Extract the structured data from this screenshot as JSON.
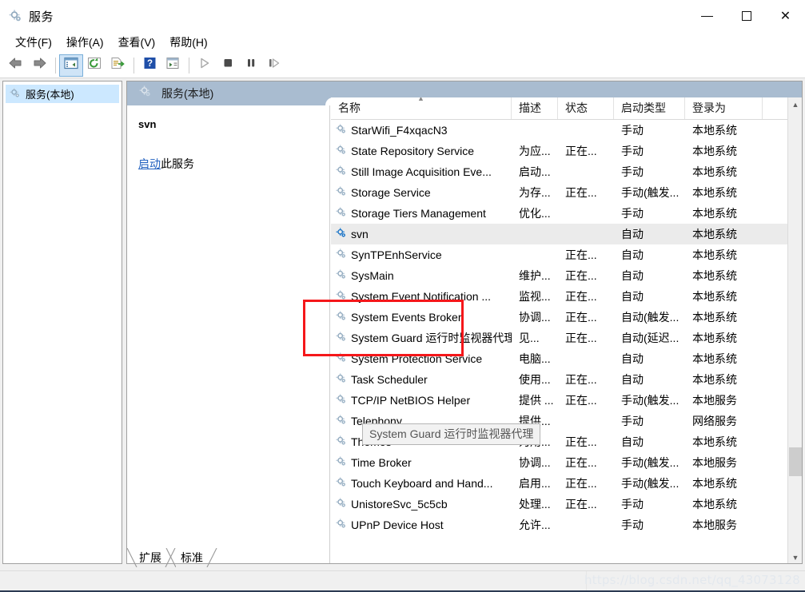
{
  "window": {
    "title": "服务",
    "icon": "services-gear-icon",
    "controls": {
      "minimize": "minimize-icon",
      "maximize": "maximize-icon",
      "close": "close-icon"
    }
  },
  "menubar": {
    "items": [
      {
        "label": "文件(F)",
        "name": "menu-file"
      },
      {
        "label": "操作(A)",
        "name": "menu-action"
      },
      {
        "label": "查看(V)",
        "name": "menu-view"
      },
      {
        "label": "帮助(H)",
        "name": "menu-help"
      }
    ]
  },
  "toolbar": {
    "buttons": [
      {
        "icon": "back-arrow-icon",
        "name": "toolbar-back"
      },
      {
        "icon": "forward-arrow-icon",
        "name": "toolbar-forward"
      },
      {
        "icon": "show-hide-console-tree-icon",
        "name": "toolbar-console-tree",
        "active": true
      },
      {
        "icon": "refresh-icon",
        "name": "toolbar-refresh"
      },
      {
        "icon": "export-list-icon",
        "name": "toolbar-export-list"
      },
      {
        "icon": "help-icon",
        "name": "toolbar-help"
      },
      {
        "icon": "properties-icon",
        "name": "toolbar-properties"
      },
      {
        "icon": "play-icon",
        "name": "toolbar-start-service"
      },
      {
        "icon": "stop-icon",
        "name": "toolbar-stop-service"
      },
      {
        "icon": "pause-icon",
        "name": "toolbar-pause-service"
      },
      {
        "icon": "restart-icon",
        "name": "toolbar-restart-service"
      }
    ]
  },
  "tree": {
    "items": [
      {
        "label": "服务(本地)",
        "icon": "services-gear-icon",
        "selected": true
      }
    ]
  },
  "pane": {
    "header_title": "服务(本地)",
    "header_icon": "services-gear-icon",
    "details": {
      "service_name": "svn",
      "action_link": "启动",
      "action_suffix": "此服务"
    }
  },
  "list": {
    "columns": [
      {
        "label": "名称",
        "name": "column-name",
        "sorted": "asc"
      },
      {
        "label": "描述",
        "name": "column-description"
      },
      {
        "label": "状态",
        "name": "column-status"
      },
      {
        "label": "启动类型",
        "name": "column-startup-type"
      },
      {
        "label": "登录为",
        "name": "column-log-on-as"
      }
    ],
    "rows": [
      {
        "name": "StarWifi_F4xqacN3",
        "desc": "",
        "state": "",
        "start": "手动",
        "logon": "本地系统",
        "selected": false
      },
      {
        "name": "State Repository Service",
        "desc": "为应...",
        "state": "正在...",
        "start": "手动",
        "logon": "本地系统",
        "selected": false
      },
      {
        "name": "Still Image Acquisition Eve...",
        "desc": "启动...",
        "state": "",
        "start": "手动",
        "logon": "本地系统",
        "selected": false
      },
      {
        "name": "Storage Service",
        "desc": "为存...",
        "state": "正在...",
        "start": "手动(触发...",
        "logon": "本地系统",
        "selected": false
      },
      {
        "name": "Storage Tiers Management",
        "desc": "优化...",
        "state": "",
        "start": "手动",
        "logon": "本地系统",
        "selected": false
      },
      {
        "name": "svn",
        "desc": "",
        "state": "",
        "start": "自动",
        "logon": "本地系统",
        "selected": true
      },
      {
        "name": "SynTPEnhService",
        "desc": "",
        "state": "正在...",
        "start": "自动",
        "logon": "本地系统",
        "selected": false
      },
      {
        "name": "SysMain",
        "desc": "维护...",
        "state": "正在...",
        "start": "自动",
        "logon": "本地系统",
        "selected": false
      },
      {
        "name": "System Event Notification ...",
        "desc": "监视...",
        "state": "正在...",
        "start": "自动",
        "logon": "本地系统",
        "selected": false
      },
      {
        "name": "System Events Broker",
        "desc": "协调...",
        "state": "正在...",
        "start": "自动(触发...",
        "logon": "本地系统",
        "selected": false
      },
      {
        "name": "System Guard 运行时监视器代理",
        "desc": "见...",
        "state": "正在...",
        "start": "自动(延迟...",
        "logon": "本地系统",
        "selected": false
      },
      {
        "name": "System Protection Service",
        "desc": "电脑...",
        "state": "",
        "start": "自动",
        "logon": "本地系统",
        "selected": false
      },
      {
        "name": "Task Scheduler",
        "desc": "使用...",
        "state": "正在...",
        "start": "自动",
        "logon": "本地系统",
        "selected": false
      },
      {
        "name": "TCP/IP NetBIOS Helper",
        "desc": "提供 ...",
        "state": "正在...",
        "start": "手动(触发...",
        "logon": "本地服务",
        "selected": false
      },
      {
        "name": "Telephony",
        "desc": "提供...",
        "state": "",
        "start": "手动",
        "logon": "网络服务",
        "selected": false
      },
      {
        "name": "Themes",
        "desc": "为用...",
        "state": "正在...",
        "start": "自动",
        "logon": "本地系统",
        "selected": false
      },
      {
        "name": "Time Broker",
        "desc": "协调...",
        "state": "正在...",
        "start": "手动(触发...",
        "logon": "本地服务",
        "selected": false
      },
      {
        "name": "Touch Keyboard and Hand...",
        "desc": "启用...",
        "state": "正在...",
        "start": "手动(触发...",
        "logon": "本地系统",
        "selected": false
      },
      {
        "name": "UnistoreSvc_5c5cb",
        "desc": "处理...",
        "state": "正在...",
        "start": "手动",
        "logon": "本地系统",
        "selected": false
      },
      {
        "name": "UPnP Device Host",
        "desc": "允许...",
        "state": "",
        "start": "手动",
        "logon": "本地服务",
        "selected": false
      }
    ],
    "tooltip": "System Guard 运行时监视器代理"
  },
  "tabs": [
    {
      "label": "扩展",
      "name": "tab-extended",
      "selected": false
    },
    {
      "label": "标准",
      "name": "tab-standard",
      "selected": true
    }
  ],
  "statusbar": {
    "watermark": "https://blog.csdn.net/qq_43073128"
  },
  "colors": {
    "pane_header": "#a9bcd0",
    "tree_selection": "#cce8ff",
    "row_selection": "#ebebeb",
    "link": "#1f5fbf",
    "annotation_red": "#f5171a",
    "toolbar_active": "#cfe4f7"
  }
}
